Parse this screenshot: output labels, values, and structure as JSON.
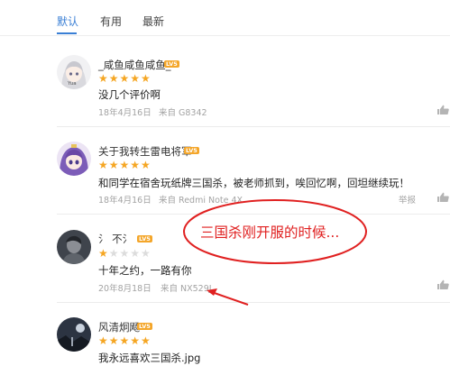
{
  "tabs": [
    {
      "label": "默认",
      "active": true
    },
    {
      "label": "有用",
      "active": false
    },
    {
      "label": "最新",
      "active": false
    }
  ],
  "colors": {
    "accent": "#3a7fd5",
    "star": "#f5a623",
    "annotation": "#e02020",
    "level_badge": "#f4a62a"
  },
  "reviews": [
    {
      "username": "_咸鱼咸鱼咸鱼_",
      "level": "LV5",
      "rating": 5,
      "content": "没几个评价啊",
      "date": "18年4月16日",
      "source": "来自 G8342",
      "avatar_caption": "Yua"
    },
    {
      "username": "关于我转生雷电将军",
      "level": "LV5",
      "rating": 5,
      "content": "和同学在宿舍玩纸牌三国杀，被老师抓到，唉回忆啊，回坦继续玩！",
      "date": "18年4月16日",
      "source": "来自 Redmi Note 4X",
      "report": "举报"
    },
    {
      "username": "氵 不氵",
      "level": "LV5",
      "rating": 1,
      "content": "十年之约，一路有你",
      "date": "20年8月18日",
      "source": "来自 NX529J"
    },
    {
      "username": "风清炯飏",
      "level": "LV5",
      "rating": 5,
      "content": "我永远喜欢三国杀.jpg"
    }
  ],
  "annotation": {
    "text": "三国杀刚开服的时候...",
    "icon": "red-ellipse-and-arrow"
  }
}
